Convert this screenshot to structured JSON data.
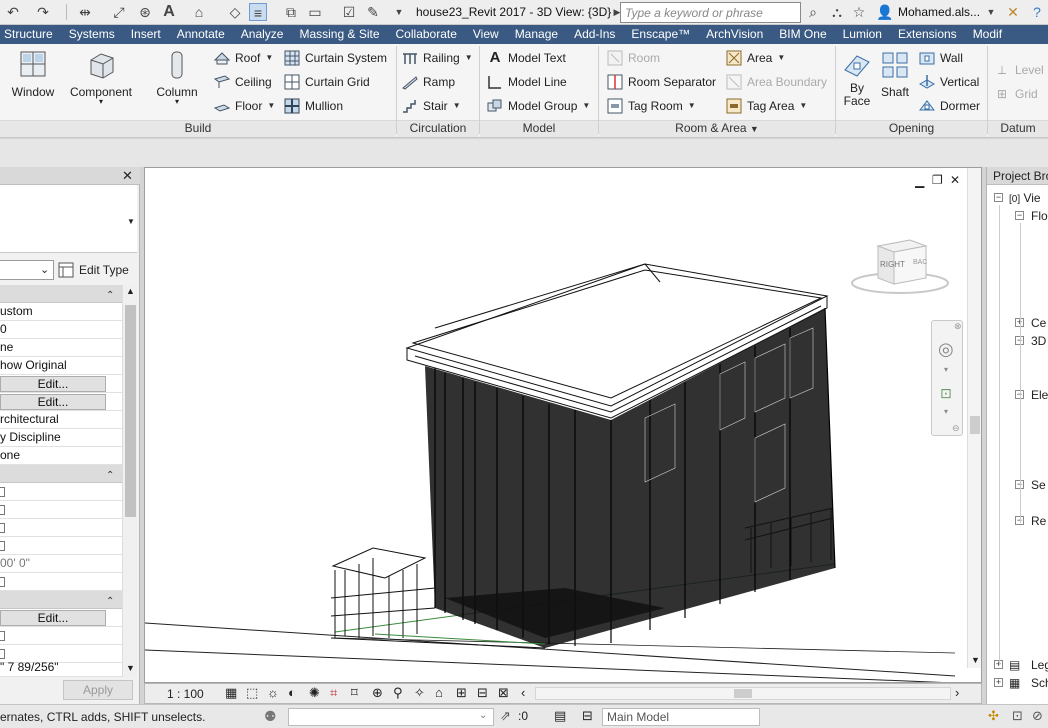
{
  "titlebar": {
    "title": "house23_Revit 2017 - 3D View: {3D}",
    "search_placeholder": "Type a keyword or phrase",
    "user": "Mohamed.als..."
  },
  "menu_tabs": [
    "Structure",
    "Systems",
    "Insert",
    "Annotate",
    "Analyze",
    "Massing & Site",
    "Collaborate",
    "View",
    "Manage",
    "Add-Ins",
    "Enscape™",
    "ArchVision",
    "BIM One",
    "Lumion",
    "Extensions",
    "Modif"
  ],
  "ribbon": {
    "build": {
      "title": "Build",
      "window": "Window",
      "component": "Component",
      "column": "Column",
      "roof": "Roof",
      "ceiling": "Ceiling",
      "floor": "Floor",
      "curtain_system": "Curtain System",
      "curtain_grid": "Curtain Grid",
      "mullion": "Mullion"
    },
    "circulation": {
      "title": "Circulation",
      "railing": "Railing",
      "ramp": "Ramp",
      "stair": "Stair"
    },
    "model": {
      "title": "Model",
      "model_text": "Model Text",
      "model_line": "Model Line",
      "model_group": "Model Group"
    },
    "room_area": {
      "title": "Room & Area",
      "room": "Room",
      "room_separator": "Room Separator",
      "tag_room": "Tag Room",
      "area": "Area",
      "area_boundary": "Area Boundary",
      "tag_area": "Tag Area"
    },
    "opening": {
      "title": "Opening",
      "by_face_1": "By",
      "by_face_2": "Face",
      "shaft": "Shaft",
      "wall": "Wall",
      "vertical": "Vertical",
      "dormer": "Dormer"
    },
    "datum": {
      "title": "Datum",
      "level": "Level",
      "grid": "Grid"
    }
  },
  "properties": {
    "edit_type": "Edit Type",
    "rows": [
      "ustom",
      "0",
      "ne",
      "how Original",
      "Edit...",
      "Edit...",
      "rchitectural",
      "y Discipline",
      "one"
    ],
    "rows2": [
      "",
      "",
      "",
      "",
      "00'  0\"",
      ""
    ],
    "edit3": "Edit...",
    "bottom_value": "\"  7 89/256\"",
    "apply": "Apply"
  },
  "viewport": {
    "scale": "1 : 100",
    "viewcube_right": "RIGHT",
    "viewcube_back": "BAC"
  },
  "browser": {
    "title": "Project Bro",
    "nodes": [
      "Vie",
      "Flo",
      "Ce",
      "3D",
      "Ele",
      "Se",
      "Re",
      "Leg",
      "Sch"
    ]
  },
  "statusbar": {
    "hint": "ernates, CTRL adds, SHIFT unselects.",
    "filter_count": ":0",
    "active_model": "Main Model"
  },
  "colors": {
    "menubar": "#3a5a83",
    "canvas": "#ffffff",
    "ribbon": "#f5f5f5"
  }
}
